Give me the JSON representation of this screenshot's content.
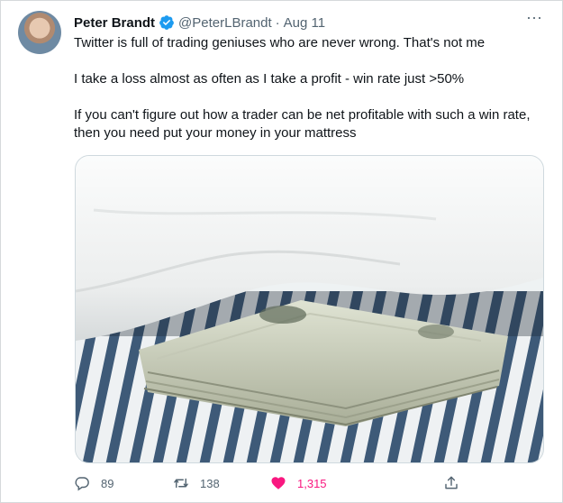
{
  "tweet": {
    "author_name": "Peter Brandt",
    "author_handle": "@PeterLBrandt",
    "separator": "·",
    "date": "Aug 11",
    "more_label": "···",
    "paragraphs": [
      "Twitter is full of trading geniuses who are never wrong. That's not me",
      "I take a loss almost as often as I take a profit - win rate just >50%",
      "If you can't figure out how a trader can be net profitable with such a win rate, then you need put your money in your mattress"
    ],
    "media_alt": "Stack of cash hidden under a mattress"
  },
  "actions": {
    "reply_count": "89",
    "retweet_count": "138",
    "like_count": "1,315"
  },
  "colors": {
    "verified": "#1d9bf0",
    "like": "#f91880",
    "secondary_text": "#536471",
    "mattress_stripe": "#3e5a78"
  },
  "icons": {
    "verified": "verified-badge-icon",
    "reply": "reply-icon",
    "retweet": "retweet-icon",
    "like": "heart-icon",
    "share": "share-icon",
    "more": "more-icon"
  }
}
